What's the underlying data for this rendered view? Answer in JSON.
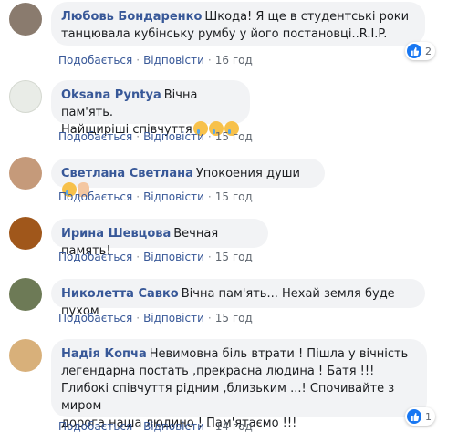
{
  "comments": [
    {
      "author": "Любовь Бондаренко",
      "text": "Шкода! Я ще в студентські роки\nтанцювала кубінську румбу у його постановці..R.I.P.",
      "like": "Подобається",
      "reply": "Відповісти",
      "time": "16 год",
      "reactions": "2",
      "avatar_color": "#8a7b6e",
      "emojis": []
    },
    {
      "author": "Oksana Pyntya",
      "text": "Вічна пам'ять.\nНайщиріші співчуття",
      "like": "Подобається",
      "reply": "Відповісти",
      "time": "15 год",
      "avatar_color": "#e9ece7",
      "emojis": [
        "crying-face-icon",
        "crying-face-icon",
        "crying-face-icon"
      ]
    },
    {
      "author": "Светлана Светлана",
      "text": "Упокоения души",
      "like": "Подобається",
      "reply": "Відповісти",
      "time": "15 год",
      "avatar_color": "#c59a7a",
      "emojis": [
        "crying-face-icon",
        "folded-hands-icon"
      ]
    },
    {
      "author": "Ирина Шевцова",
      "text": "Вечная память!",
      "like": "Подобається",
      "reply": "Відповісти",
      "time": "15 год",
      "avatar_color": "#a0571b",
      "emojis": []
    },
    {
      "author": "Николетта Савко",
      "text": "Вічна пам'ять... Нехай земля буде пухом",
      "like": "Подобається",
      "reply": "Відповісти",
      "time": "15 год",
      "avatar_color": "#6d7a56",
      "emojis": []
    },
    {
      "author": "Надія Копча",
      "text": "Невимовна біль втрати ! Пішла у вічність\nлегендарна постать ,прекрасна людина ! Батя !!!\nГлибокі співчуття рідним ,близьким ...! Спочивайте з миром\nдорога наша людино ! Пам'ятаємо !!!",
      "like": "Подобається",
      "reply": "Відповісти",
      "time": "14 год",
      "reactions": "1",
      "avatar_color": "#d8b07a",
      "emojis": []
    }
  ],
  "colors": {
    "link": "#385898",
    "bubble": "#f2f3f5",
    "like_blue": "#1877f2"
  }
}
